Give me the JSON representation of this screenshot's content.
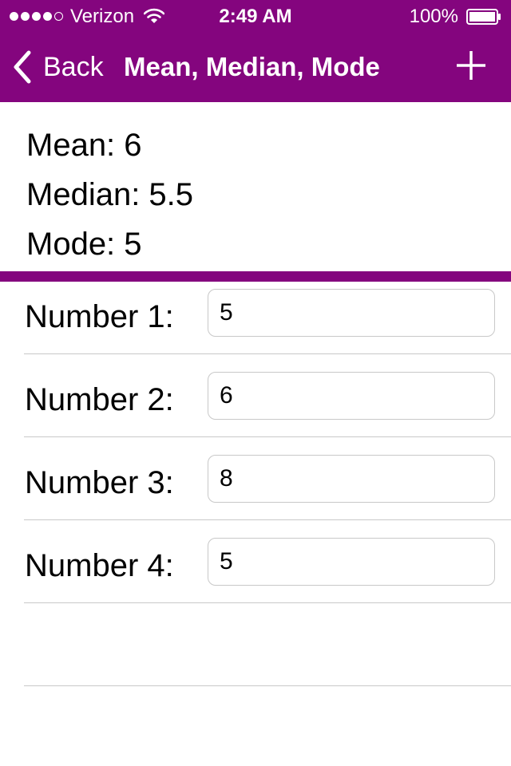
{
  "status_bar": {
    "carrier": "Verizon",
    "time": "2:49 AM",
    "battery_percent": "100%",
    "signal_bars_filled": 4,
    "signal_bars_total": 5
  },
  "nav": {
    "back_label": "Back",
    "title": "Mean, Median, Mode",
    "add_icon": "plus-icon"
  },
  "results": {
    "mean": "Mean: 6",
    "median": "Median: 5.5",
    "mode": "Mode: 5"
  },
  "numbers": [
    {
      "label": "Number 1:",
      "value": "5"
    },
    {
      "label": "Number 2:",
      "value": "6"
    },
    {
      "label": "Number 3:",
      "value": "8"
    },
    {
      "label": "Number 4:",
      "value": "5"
    }
  ],
  "colors": {
    "accent": "#84057e",
    "separator": "#c8c8c8"
  }
}
